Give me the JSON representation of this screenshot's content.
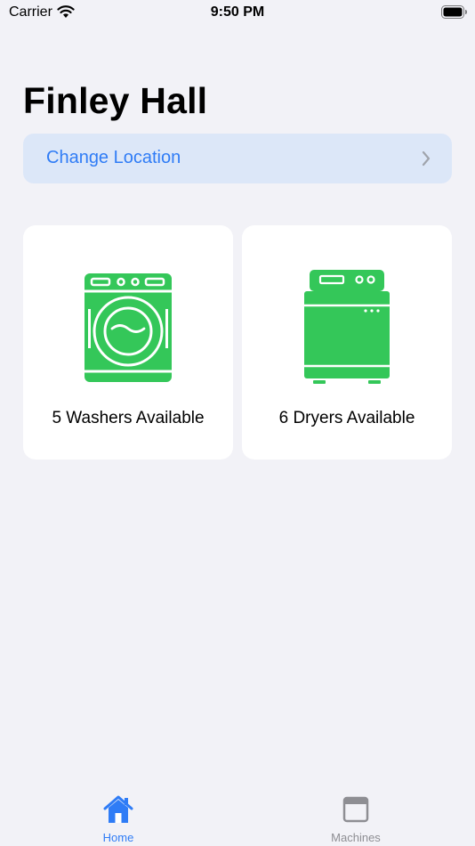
{
  "status_bar": {
    "carrier": "Carrier",
    "time": "9:50 PM"
  },
  "header": {
    "title": "Finley Hall"
  },
  "location_button": {
    "label": "Change Location",
    "icon": "chevron-right-icon"
  },
  "cards": {
    "washers": {
      "label": "5 Washers Available",
      "icon": "washer-icon"
    },
    "dryers": {
      "label": "6 Dryers Available",
      "icon": "dryer-icon"
    }
  },
  "tab_bar": {
    "tabs": [
      {
        "label": "Home",
        "icon": "house-icon",
        "selected": true
      },
      {
        "label": "Machines",
        "icon": "window-icon",
        "selected": false
      }
    ]
  },
  "colors": {
    "background": "#F2F2F7",
    "accent": "#2F7CF6",
    "appliance_green": "#34C759",
    "inactive_tab": "#8E8E93",
    "location_button_bg": "#DCE7F8"
  }
}
